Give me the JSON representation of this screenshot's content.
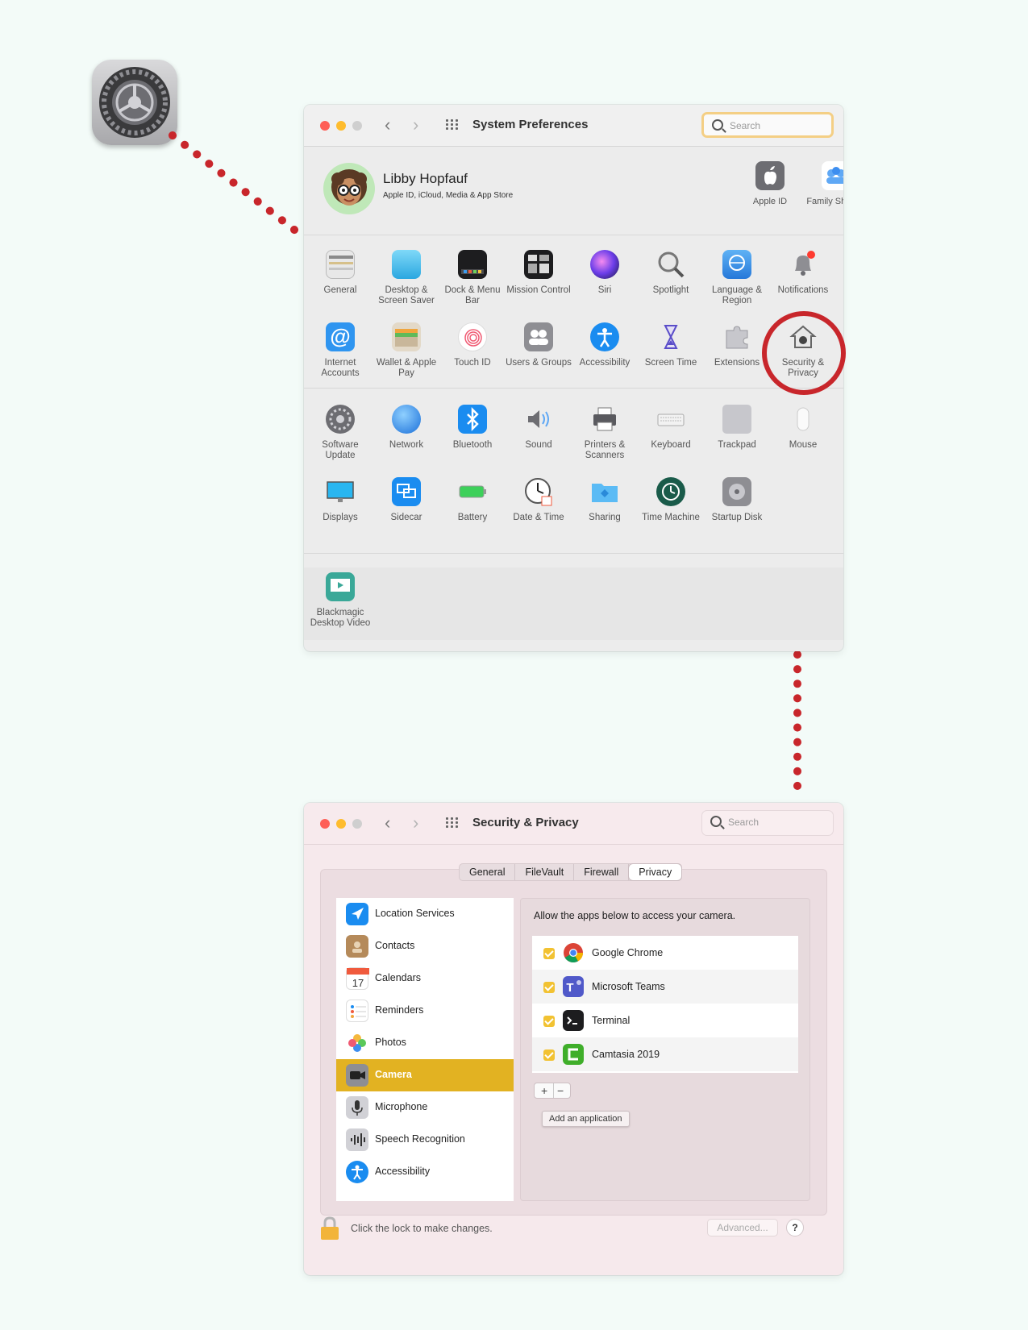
{
  "colors": {
    "background": "#f3fbf8",
    "connector": "#c8262b",
    "selection": "#e2b222"
  },
  "window1": {
    "title": "System Preferences",
    "search_placeholder": "Search",
    "user": {
      "name": "Libby Hopfauf",
      "subtitle": "Apple ID, iCloud, Media & App Store"
    },
    "profile_items": [
      {
        "label": "Apple ID",
        "icon": "apple-logo-icon"
      },
      {
        "label": "Family Sharing",
        "icon": "family-sharing-icon"
      }
    ],
    "prefs": [
      {
        "label": "General",
        "icon": "general-icon"
      },
      {
        "label": "Desktop & Screen Saver",
        "icon": "desktop-icon"
      },
      {
        "label": "Dock & Menu Bar",
        "icon": "dock-icon"
      },
      {
        "label": "Mission Control",
        "icon": "mission-control-icon"
      },
      {
        "label": "Siri",
        "icon": "siri-icon"
      },
      {
        "label": "Spotlight",
        "icon": "spotlight-icon"
      },
      {
        "label": "Language & Region",
        "icon": "language-icon"
      },
      {
        "label": "Notifications",
        "icon": "bell-icon"
      },
      {
        "label": "Internet Accounts",
        "icon": "at-icon"
      },
      {
        "label": "Wallet & Apple Pay",
        "icon": "wallet-icon"
      },
      {
        "label": "Touch ID",
        "icon": "fingerprint-icon"
      },
      {
        "label": "Users & Groups",
        "icon": "users-icon"
      },
      {
        "label": "Accessibility",
        "icon": "accessibility-icon"
      },
      {
        "label": "Screen Time",
        "icon": "hourglass-icon"
      },
      {
        "label": "Extensions",
        "icon": "puzzle-icon"
      },
      {
        "label": "Security & Privacy",
        "icon": "house-lock-icon"
      },
      {
        "label": "Software Update",
        "icon": "gear-icon"
      },
      {
        "label": "Network",
        "icon": "globe-icon"
      },
      {
        "label": "Bluetooth",
        "icon": "bluetooth-icon"
      },
      {
        "label": "Sound",
        "icon": "speaker-icon"
      },
      {
        "label": "Printers & Scanners",
        "icon": "printer-icon"
      },
      {
        "label": "Keyboard",
        "icon": "keyboard-icon"
      },
      {
        "label": "Trackpad",
        "icon": "trackpad-icon"
      },
      {
        "label": "Mouse",
        "icon": "mouse-icon"
      },
      {
        "label": "Displays",
        "icon": "display-icon"
      },
      {
        "label": "Sidecar",
        "icon": "sidecar-icon"
      },
      {
        "label": "Battery",
        "icon": "battery-icon"
      },
      {
        "label": "Date & Time",
        "icon": "clock-icon"
      },
      {
        "label": "Sharing",
        "icon": "folder-icon"
      },
      {
        "label": "Time Machine",
        "icon": "time-machine-icon"
      },
      {
        "label": "Startup Disk",
        "icon": "disk-icon"
      }
    ],
    "third_party": [
      {
        "label": "Blackmagic Desktop Video",
        "icon": "blackmagic-icon"
      }
    ]
  },
  "window2": {
    "title": "Security & Privacy",
    "search_placeholder": "Search",
    "tabs": [
      "General",
      "FileVault",
      "Firewall",
      "Privacy"
    ],
    "active_tab": "Privacy",
    "sidebar": [
      {
        "label": "Location Services",
        "icon": "location-arrow-icon"
      },
      {
        "label": "Contacts",
        "icon": "contacts-icon"
      },
      {
        "label": "Calendars",
        "icon": "calendar-icon"
      },
      {
        "label": "Reminders",
        "icon": "reminders-icon"
      },
      {
        "label": "Photos",
        "icon": "photos-icon"
      },
      {
        "label": "Camera",
        "icon": "camera-icon"
      },
      {
        "label": "Microphone",
        "icon": "microphone-icon"
      },
      {
        "label": "Speech Recognition",
        "icon": "waveform-icon"
      },
      {
        "label": "Accessibility",
        "icon": "accessibility-icon"
      }
    ],
    "selected": "Camera",
    "description": "Allow the apps below to access your camera.",
    "apps": [
      {
        "label": "Google Chrome",
        "icon": "chrome-icon",
        "checked": true
      },
      {
        "label": "Microsoft Teams",
        "icon": "teams-icon",
        "checked": true
      },
      {
        "label": "Terminal",
        "icon": "terminal-icon",
        "checked": true
      },
      {
        "label": "Camtasia 2019",
        "icon": "camtasia-icon",
        "checked": true
      }
    ],
    "plus": "+",
    "minus": "−",
    "tooltip": "Add an application",
    "lock_text": "Click the lock to make changes.",
    "advanced_label": "Advanced...",
    "help_label": "?"
  }
}
